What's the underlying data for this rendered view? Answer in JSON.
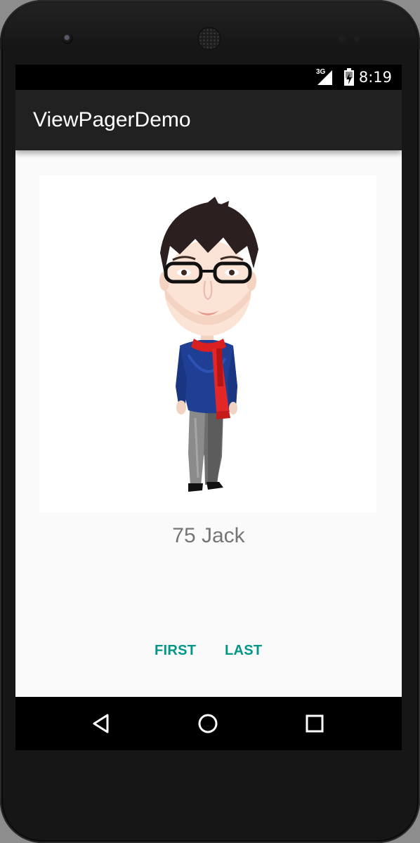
{
  "status_bar": {
    "network_type": "3G",
    "time": "8:19",
    "icons": [
      "signal-icon",
      "battery-charging-icon"
    ]
  },
  "app_bar": {
    "title": "ViewPagerDemo"
  },
  "page": {
    "image_subject": "cartoon-man-with-glasses-and-red-scarf",
    "caption": "75 Jack"
  },
  "buttons": {
    "first_label": "FIRST",
    "last_label": "LAST"
  },
  "navigation": {
    "icons": [
      "back-icon",
      "home-icon",
      "recents-icon"
    ]
  },
  "colors": {
    "accent": "#009688",
    "app_bar": "#212121",
    "background": "#fafafa",
    "caption_text": "#757575"
  }
}
